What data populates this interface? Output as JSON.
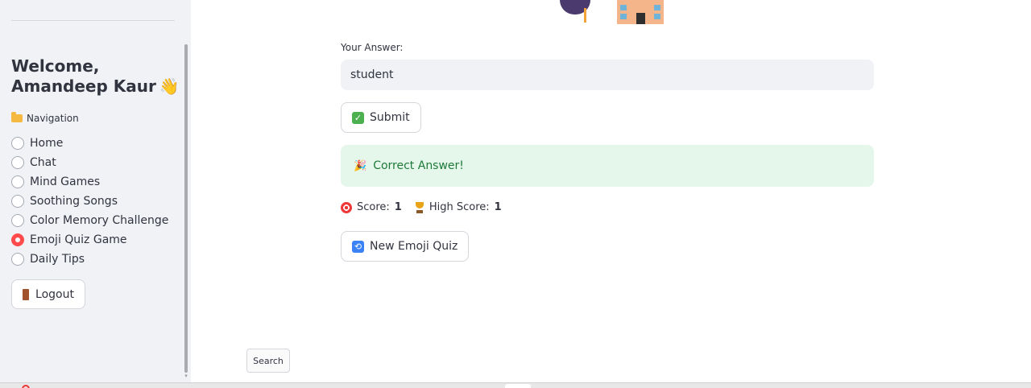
{
  "sidebar": {
    "welcome_line1": "Welcome,",
    "welcome_line2": "Amandeep Kaur",
    "wave_emoji": "👋",
    "nav_label": "Navigation",
    "nav_icon": "folder-icon",
    "items": [
      {
        "label": "Home",
        "selected": false
      },
      {
        "label": "Chat",
        "selected": false
      },
      {
        "label": "Mind Games",
        "selected": false
      },
      {
        "label": "Soothing Songs",
        "selected": false
      },
      {
        "label": "Color Memory Challenge",
        "selected": false
      },
      {
        "label": "Emoji Quiz Game",
        "selected": true
      },
      {
        "label": "Daily Tips",
        "selected": false
      }
    ],
    "logout_label": "Logout",
    "logout_icon": "door-icon"
  },
  "main": {
    "emoji_clue": [
      "graduation-cap-icon",
      "school-icon"
    ],
    "answer_label": "Your Answer:",
    "answer_value": "student",
    "submit_label": "Submit",
    "submit_icon": "check-box-icon",
    "result_message": "Correct Answer!",
    "result_icon": "party-popper-icon",
    "score_label": "Score:",
    "score_value": "1",
    "high_score_label": "High Score:",
    "high_score_value": "1",
    "new_quiz_label": "New Emoji Quiz",
    "new_quiz_icon": "repeat-icon",
    "search_label": "Search"
  },
  "colors": {
    "accent": "#ff4b4b",
    "sidebar_bg": "#f0f2f6",
    "success_bg": "#e5f6ea",
    "success_text": "#1f7a3a"
  }
}
